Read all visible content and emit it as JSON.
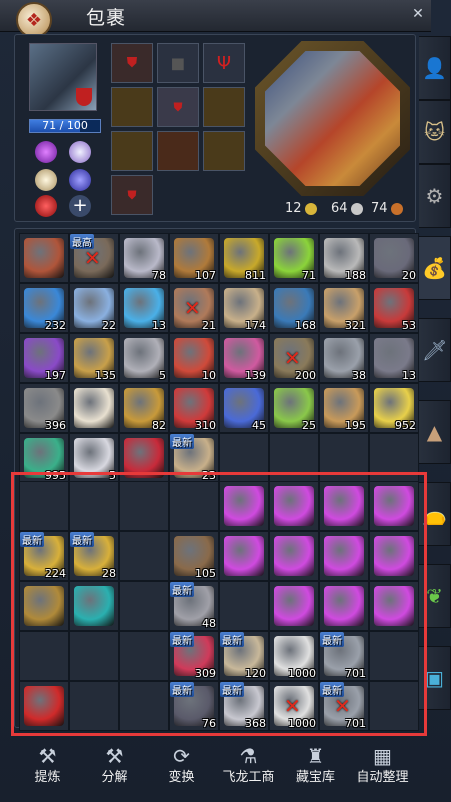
{
  "window": {
    "title": "包裹"
  },
  "equipment": {
    "hp_text": "71 / 100",
    "hp_fraction": 0.71,
    "currency": [
      {
        "amount": "12",
        "color": "#d8b53a"
      },
      {
        "amount": "64",
        "color": "#c8c8c8"
      },
      {
        "amount": "74",
        "color": "#c8702a"
      }
    ]
  },
  "inventory": {
    "rows": [
      [
        {
          "c": "#b0553a"
        },
        {
          "c": "#7a6a5a",
          "label": "最高",
          "x": true
        },
        {
          "c": "#b9b9c9",
          "n": "78"
        },
        {
          "c": "#b07a3a",
          "n": "107"
        },
        {
          "c": "#c8a92a",
          "n": "811"
        },
        {
          "c": "#8bd43a",
          "n": "71"
        },
        {
          "c": "#b9b9b9",
          "n": "188"
        },
        {
          "c": "#6a6a7a",
          "n": "20"
        }
      ],
      [
        {
          "c": "#3a88d8",
          "n": "232"
        },
        {
          "c": "#8ab0e0",
          "n": "22"
        },
        {
          "c": "#4ab0e8",
          "n": "13"
        },
        {
          "c": "#b07a5a",
          "n": "21",
          "x": true
        },
        {
          "c": "#c8b08a",
          "n": "174"
        },
        {
          "c": "#3a7ab8",
          "n": "168"
        },
        {
          "c": "#c8a06a",
          "n": "321"
        },
        {
          "c": "#c83a3a",
          "n": "53"
        }
      ],
      [
        {
          "c": "#8a4ac8",
          "n": "197"
        },
        {
          "c": "#c8a04a",
          "n": "135"
        },
        {
          "c": "#b0b0b8",
          "n": "5"
        },
        {
          "c": "#d04a3a",
          "n": "10"
        },
        {
          "c": "#d05aa0",
          "n": "139"
        },
        {
          "c": "#8a7a5a",
          "n": "200",
          "x": true
        },
        {
          "c": "#9aa0aa",
          "n": "38"
        },
        {
          "c": "#7a7a8a",
          "n": "13"
        }
      ],
      [
        {
          "c": "#8a8a8a",
          "n": "396"
        },
        {
          "c": "#e8e0d0"
        },
        {
          "c": "#c89a3a",
          "n": "82"
        },
        {
          "c": "#d03a3a",
          "n": "310"
        },
        {
          "c": "#4a6ad8",
          "n": "45"
        },
        {
          "c": "#8ac84a",
          "n": "25"
        },
        {
          "c": "#c89a5a",
          "n": "195"
        },
        {
          "c": "#e8d04a",
          "n": "952"
        }
      ],
      [
        {
          "c": "#3ab08a",
          "n": "995"
        },
        {
          "c": "#d8d8e0",
          "n": "5"
        },
        {
          "c": "#c82a3a"
        },
        {
          "c": "#c8b08a",
          "n": "23",
          "label": "最新"
        },
        {},
        {},
        {},
        {}
      ],
      [
        {},
        {},
        {},
        {},
        {
          "c": "#d04ae0"
        },
        {
          "c": "#d04ae0"
        },
        {
          "c": "#d04ae0"
        },
        {
          "c": "#d04ae0"
        }
      ],
      [
        {
          "c": "#d8b03a",
          "n": "224",
          "label": "最新"
        },
        {
          "c": "#d8b03a",
          "n": "28",
          "label": "最新"
        },
        {},
        {
          "c": "#8a6a4a",
          "n": "105"
        },
        {
          "c": "#d04ae0"
        },
        {
          "c": "#d04ae0"
        },
        {
          "c": "#d04ae0"
        },
        {
          "c": "#d04ae0"
        }
      ],
      [
        {
          "c": "#b08a3a"
        },
        {
          "c": "#2ab0b0"
        },
        {},
        {
          "c": "#a0a0a8",
          "n": "48",
          "label": "最新"
        },
        {},
        {
          "c": "#d04ae0"
        },
        {
          "c": "#d04ae0"
        },
        {
          "c": "#d04ae0"
        }
      ],
      [
        {},
        {},
        {},
        {
          "c": "#d03a5a",
          "n": "309",
          "label": "最新"
        },
        {
          "c": "#c8b89a",
          "n": "120",
          "label": "最新"
        },
        {
          "c": "#e0e0e0",
          "n": "1000"
        },
        {
          "c": "#9aa0aa",
          "n": "701",
          "label": "最新"
        },
        {}
      ],
      [
        {
          "c": "#d02a2a"
        },
        {},
        {},
        {
          "c": "#5a5a6a",
          "n": "76",
          "label": "最新"
        },
        {
          "c": "#c8c8d0",
          "n": "368",
          "label": "最新"
        },
        {
          "c": "#e0e0e0",
          "n": "1000",
          "x": true
        },
        {
          "c": "#9aa0aa",
          "n": "701",
          "label": "最新",
          "x": true
        },
        {}
      ]
    ]
  },
  "toolbar": {
    "items": [
      {
        "label": "提炼",
        "icon": "wrench-icon",
        "glyph": "⚒"
      },
      {
        "label": "分解",
        "icon": "hammer-icon",
        "glyph": "⚒"
      },
      {
        "label": "变换",
        "icon": "transform-icon",
        "glyph": "⟳"
      },
      {
        "label": "飞龙工商",
        "icon": "merchant-icon",
        "glyph": "⚗"
      },
      {
        "label": "藏宝库",
        "icon": "treasure-icon",
        "glyph": "♜"
      },
      {
        "label": "自动整理",
        "icon": "grid-icon",
        "glyph": "▦"
      }
    ]
  }
}
